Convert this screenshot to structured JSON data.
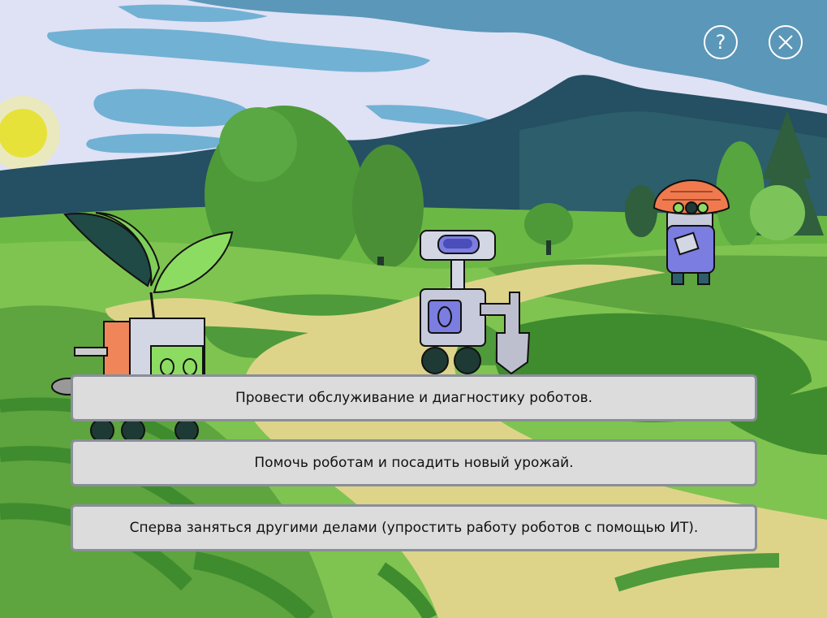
{
  "header": {
    "help_icon": "question-icon",
    "help_glyph": "?",
    "close_icon": "close-icon"
  },
  "choices": [
    {
      "label": "Провести обслуживание и диагностику роботов."
    },
    {
      "label": "Помочь роботам и посадить новый урожай."
    },
    {
      "label": "Сперва заняться другими делами (упростить работу роботов с помощью ИТ)."
    }
  ],
  "colors": {
    "sky": "#dfe1f5",
    "mountain": "#254f63",
    "meadow": "#6cb845",
    "path": "#ddd48a",
    "button_bg": "#dcdcdc",
    "button_border": "#8a8e99"
  }
}
